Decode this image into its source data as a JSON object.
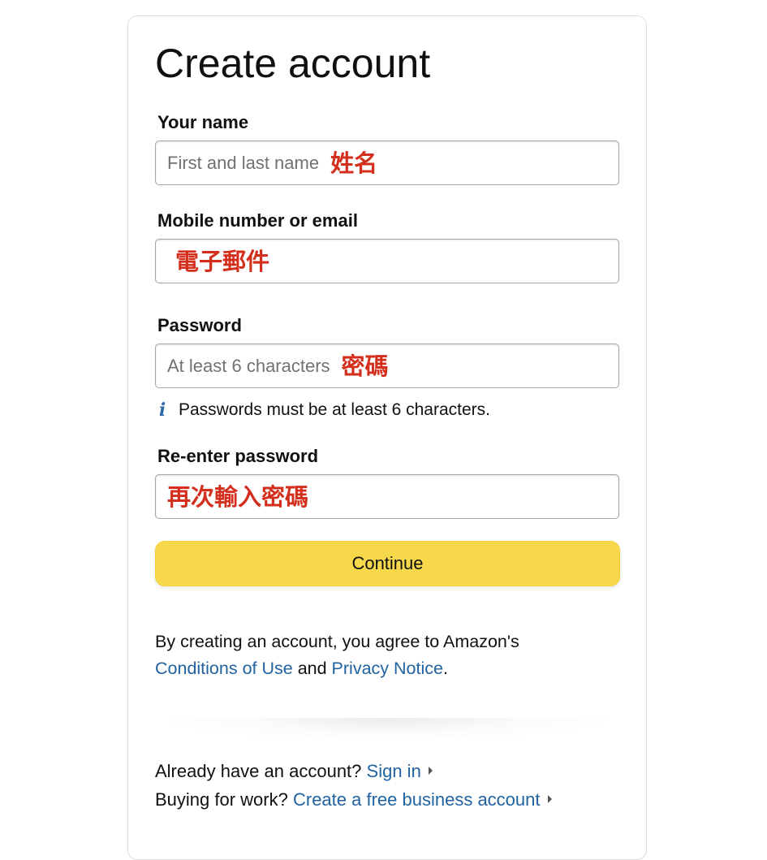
{
  "page": {
    "title": "Create account"
  },
  "name_field": {
    "label": "Your name",
    "placeholder": "First and last name",
    "annotation": "姓名"
  },
  "email_field": {
    "label": "Mobile number or email",
    "annotation": "電子郵件"
  },
  "password_field": {
    "label": "Password",
    "placeholder": "At least 6 characters",
    "annotation": "密碼",
    "hint": "Passwords must be at least 6 characters.",
    "hint_icon": "info-icon"
  },
  "reenter_field": {
    "label": "Re-enter password",
    "annotation": "再次輸入密碼"
  },
  "continue_button": {
    "label": "Continue"
  },
  "legal": {
    "prefix": "By creating an account, you agree to Amazon's",
    "conditions_link": "Conditions of Use",
    "and": "and",
    "privacy_link": "Privacy Notice",
    "suffix": "."
  },
  "signin": {
    "prompt": "Already have an account?",
    "link": "Sign in"
  },
  "business": {
    "prompt": "Buying for work?",
    "link": "Create a free business account"
  },
  "colors": {
    "accent_button": "#f7d84a",
    "link": "#2162a1",
    "annotation": "#d32f1c"
  }
}
